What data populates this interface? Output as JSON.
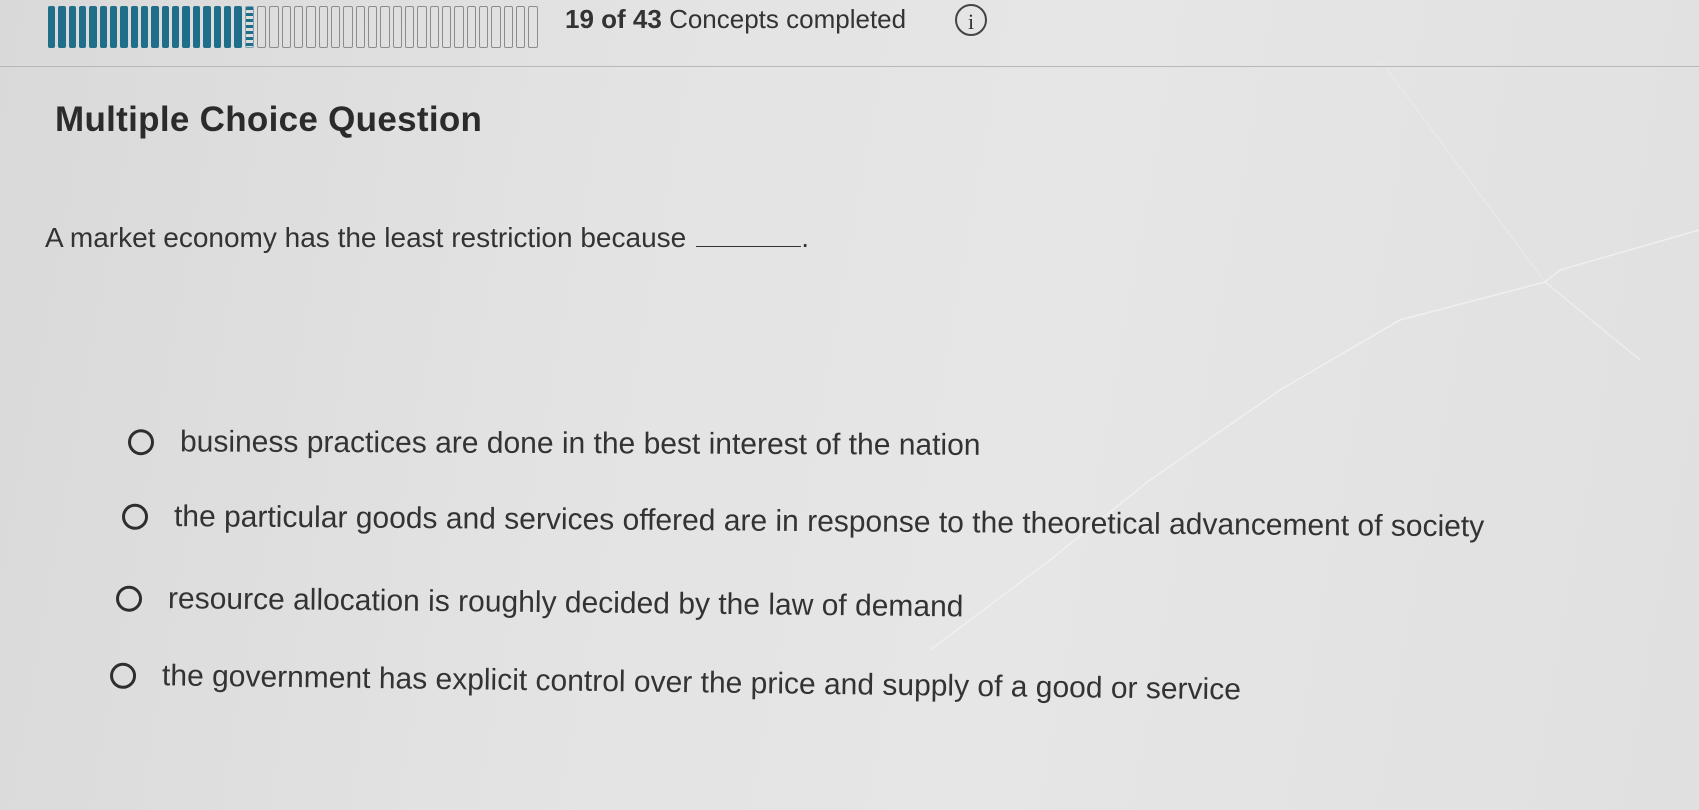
{
  "progress": {
    "completed": 19,
    "total": 43,
    "count_text": "19 of 43",
    "label": "Concepts completed",
    "accent_color": "#1f6f8b"
  },
  "info_icon": "info-icon",
  "info_glyph": "i",
  "question": {
    "type": "Multiple Choice Question",
    "prompt": "A market economy has the least restriction because",
    "prompt_end": ".",
    "options": [
      "business practices are done in the best interest of the nation",
      "the particular goods and services offered are in response to the theoretical advancement of society",
      "resource allocation is roughly decided by the law of demand",
      "the government has explicit control over the price and supply of a good or service"
    ]
  }
}
